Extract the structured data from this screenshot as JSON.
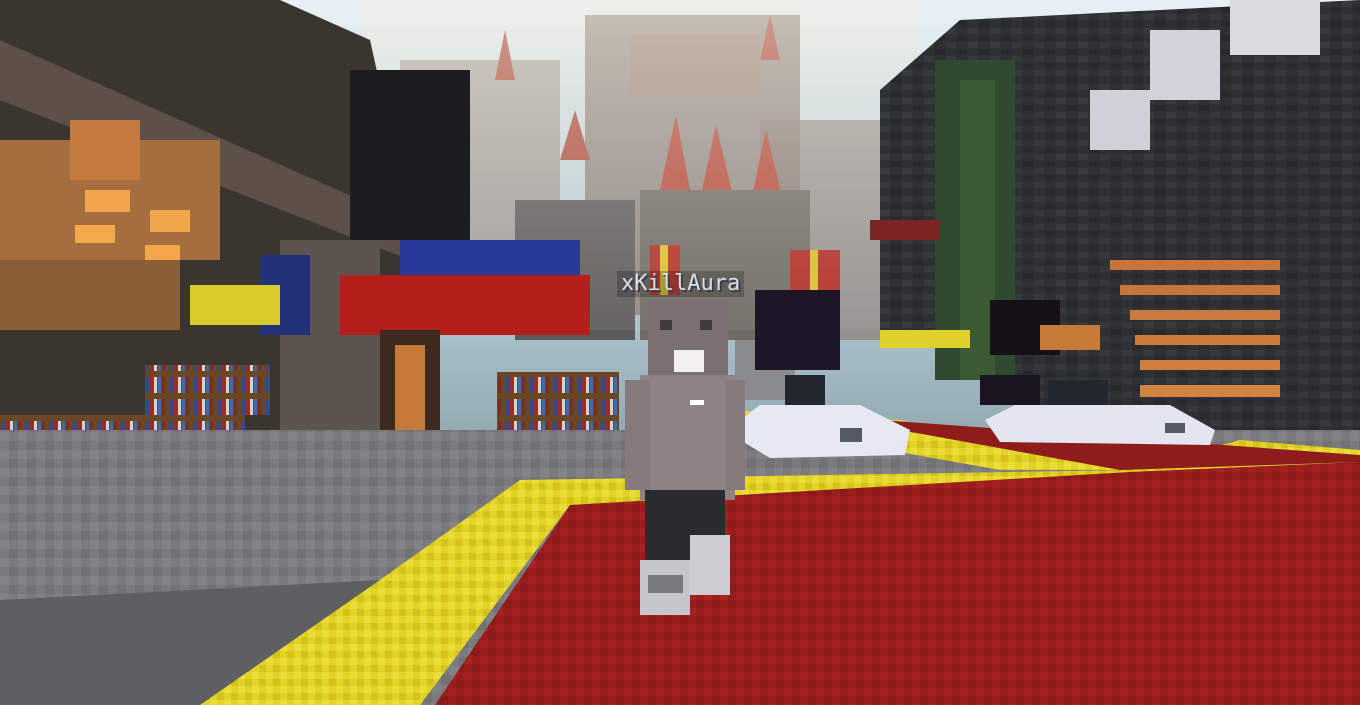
{
  "game": {
    "title": "",
    "player": {
      "name_tag": "xKillAura",
      "skin_colors": {
        "torso": "#8f8285",
        "legs": "#2b2b30",
        "shoes": "#c9c8cf",
        "head": "#7c7072"
      }
    },
    "scene": {
      "description_colors": {
        "sky": "#cfe3ee",
        "red_carpet": "#9a1f1c",
        "yellow_border": "#e3d42a",
        "stone_path": "#7f7e80",
        "quartz_bench": "#e4e6f2",
        "castle": "#8a7f79"
      }
    }
  }
}
